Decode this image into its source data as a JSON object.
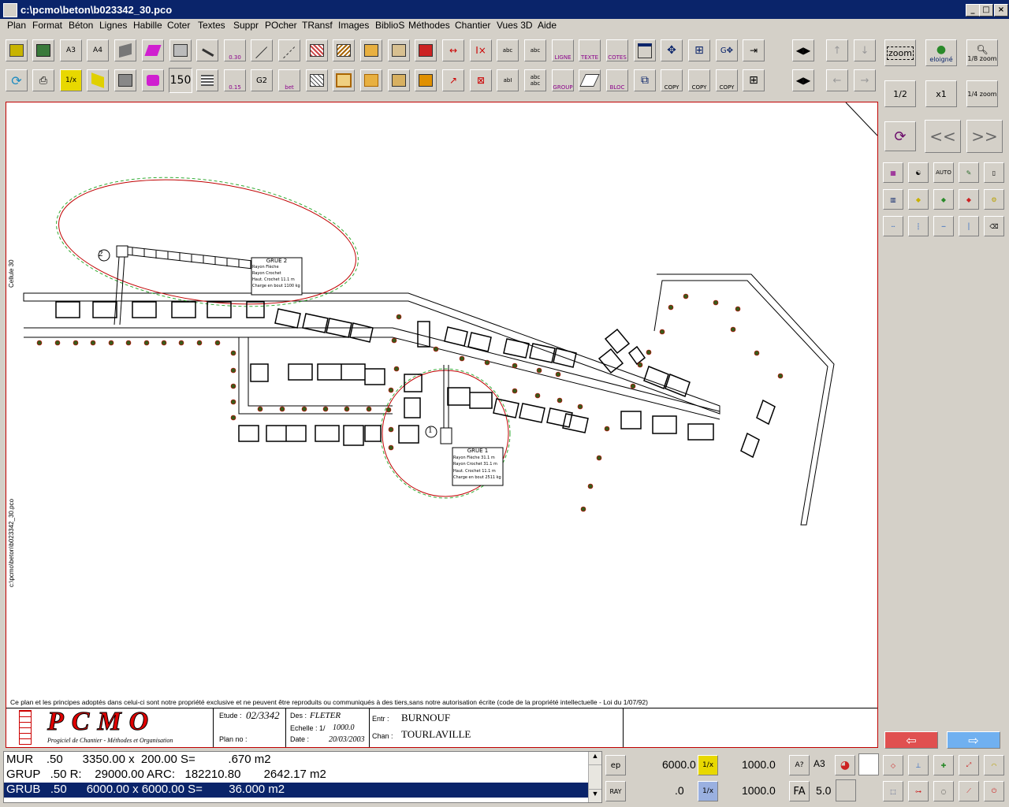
{
  "window": {
    "title": "c:\\pcmo\\beton\\b023342_30.pco"
  },
  "menu": [
    "Plan",
    "Format",
    "Béton",
    "Lignes",
    "Habille",
    "Coter",
    "Textes",
    "Suppr",
    "POcher",
    "TRansf",
    "Images",
    "BiblioS",
    "Méthodes",
    "Chantier",
    "Vues 3D",
    "Aide"
  ],
  "toolbar": {
    "btn_a3": "A3",
    "btn_a4": "A4",
    "btn_030": "0.30",
    "btn_abc": "abc",
    "btn_abc2": "abc",
    "btn_ligne": "LIGNE",
    "btn_texte": "TEXTE",
    "btn_cotes": "COTES",
    "btn_1x": "1/x",
    "btn_150": "150",
    "btn_015": "0.15",
    "btn_g2": "G2",
    "btn_bet": "bet",
    "btn_abi": "abI",
    "btn_abc3": "abc abc",
    "btn_group": "GROUP",
    "btn_bloc": "BLOC",
    "btn_copy1": "COPY",
    "btn_copy2": "COPY",
    "btn_copy3": "COPY"
  },
  "right_panel": {
    "zoom": "zoom",
    "eloigne": "eloigné",
    "zoom18": "1/8 zoom",
    "half": "1/2",
    "x1": "x1",
    "zoom14": "1/4 zoom",
    "prev": "<<",
    "next": ">>",
    "auto": "AUTO"
  },
  "drawing": {
    "grue2": {
      "title": "GRUE 2",
      "lines": [
        "Rayon Flèche",
        "Rayon Crochet",
        "Haut. Crochet",
        "Charge en bout"
      ],
      "values": [
        "",
        "",
        "11.1 m",
        "1100 kg"
      ]
    },
    "grue1": {
      "title": "GRUE 1",
      "lines": [
        "Rayon Flèche",
        "Rayon Crochet",
        "Haut. Crochet",
        "Charge en bout"
      ],
      "values": [
        "31.1 m",
        "31.1 m",
        "11.1 m",
        "2511 kg"
      ]
    },
    "marker1": "1",
    "marker2": "2",
    "cellule": "Cellule 30",
    "side_path": "c:\\pcmo\\beton\\b023342_30.pco",
    "legal": "Ce plan et les principes adoptés dans celui-ci sont notre propriété exclusive et ne peuvent être reproduits ou communiqués à des tiers,sans notre autorisation écrite (code de la propriété intellectuelle - Loi du 1/07/92)",
    "logo_text": "PCMO",
    "logo_sub": "Progiciel de Chantier - Méthodes et Organisation",
    "etude_label": "Etude :",
    "etude": "02/3342",
    "plan_label": "Plan no :",
    "des_label": "Des :",
    "des": "FLETER",
    "echelle_label": "Echelle : 1/",
    "echelle": "1000.0",
    "date_label": "Date :",
    "date": "20/03/2003",
    "entr_label": "Entr :",
    "entr": "BURNOUF",
    "chan_label": "Chan :",
    "chan": "TOURLAVILLE"
  },
  "status_rows": [
    "MUR    .50      3350.00 x  200.00 S=          .670 m2",
    "GRUP   .50 R:    29000.00 ARC:   182210.80       2642.17 m2",
    "GRUB   .50      6000.00 x 6000.00 S=        36.000 m2"
  ],
  "bottom": {
    "ep": "ep",
    "ray": "RAY",
    "v1": "6000.0",
    "v2": "1000.0",
    "v3": ".0",
    "v4": "1000.0",
    "a3": "A3",
    "fa": "FA",
    "fa_val": "5.0",
    "b_1x": "1/x",
    "b_1x2": "1/x",
    "b_q": "A?"
  }
}
